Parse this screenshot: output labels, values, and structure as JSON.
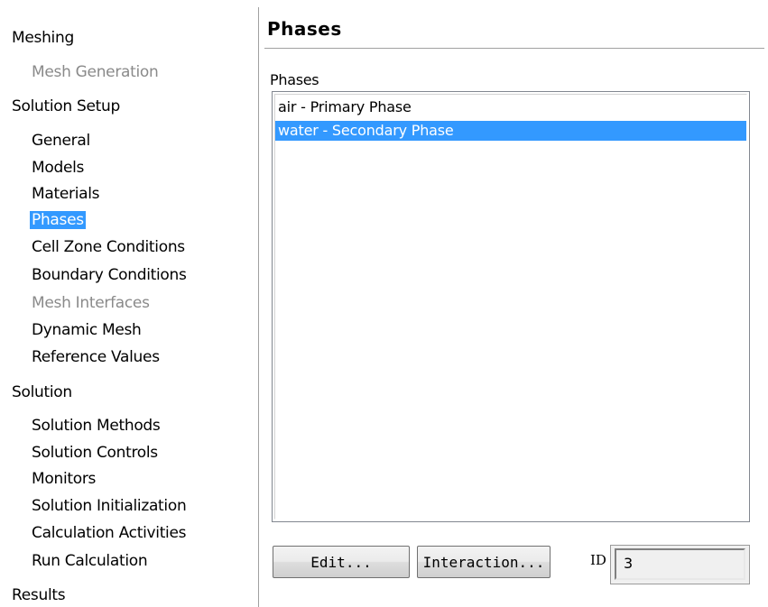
{
  "nav": {
    "items": [
      {
        "label": "Meshing",
        "state": "normal"
      },
      {
        "label": "Mesh Generation",
        "state": "disabled"
      },
      {
        "label": "Solution Setup",
        "state": "normal"
      },
      {
        "label": "General",
        "state": "normal"
      },
      {
        "label": "Models",
        "state": "normal"
      },
      {
        "label": "Materials",
        "state": "normal"
      },
      {
        "label": "Phases",
        "state": "selected"
      },
      {
        "label": "Cell Zone Conditions",
        "state": "normal"
      },
      {
        "label": "Boundary Conditions",
        "state": "normal"
      },
      {
        "label": "Mesh Interfaces",
        "state": "disabled"
      },
      {
        "label": "Dynamic Mesh",
        "state": "normal"
      },
      {
        "label": "Reference Values",
        "state": "normal"
      },
      {
        "label": "Solution",
        "state": "normal"
      },
      {
        "label": "Solution Methods",
        "state": "normal"
      },
      {
        "label": "Solution Controls",
        "state": "normal"
      },
      {
        "label": "Monitors",
        "state": "normal"
      },
      {
        "label": "Solution Initialization",
        "state": "normal"
      },
      {
        "label": "Calculation Activities",
        "state": "normal"
      },
      {
        "label": "Run Calculation",
        "state": "normal"
      },
      {
        "label": "Results",
        "state": "normal"
      }
    ]
  },
  "panel": {
    "title": "Phases",
    "list_label": "Phases",
    "phases": [
      {
        "label": "air - Primary Phase",
        "selected": false
      },
      {
        "label": "water - Secondary Phase",
        "selected": true
      }
    ],
    "edit_label": "Edit...",
    "interaction_label": "Interaction...",
    "id_label": "ID",
    "id_value": "3"
  },
  "colors": {
    "selection": "#3399ff",
    "disabled_text": "#8a8a8a"
  }
}
